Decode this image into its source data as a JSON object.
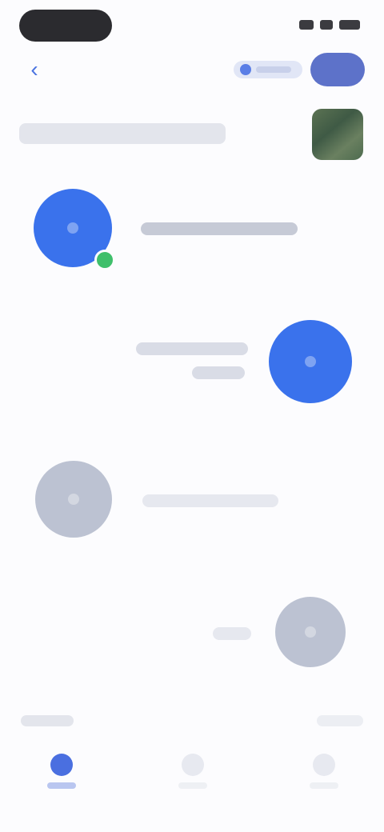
{
  "colors": {
    "accent": "#3a72ec",
    "action_pill": "#5d72c9",
    "online": "#3fbf6b",
    "muted_avatar": "#bcc2d2"
  },
  "status_bar": {
    "icons": [
      "signal-icon",
      "wifi-icon",
      "battery-icon"
    ]
  },
  "top_bar": {
    "back_icon": "chevron-left-icon",
    "pill_icon": "user-icon"
  },
  "header": {
    "thumbnail_icon": "photo-thumbnail"
  },
  "messages": [
    {
      "side": "left",
      "avatar": "blue",
      "online": true
    },
    {
      "side": "right",
      "avatar": "blue",
      "online": false
    },
    {
      "side": "left",
      "avatar": "grey",
      "online": false
    },
    {
      "side": "right",
      "avatar": "grey",
      "online": false
    }
  ],
  "tab_bar": {
    "tabs": [
      {
        "icon": "home-icon",
        "active": true
      },
      {
        "icon": "search-icon",
        "active": false
      },
      {
        "icon": "profile-icon",
        "active": false
      }
    ]
  }
}
